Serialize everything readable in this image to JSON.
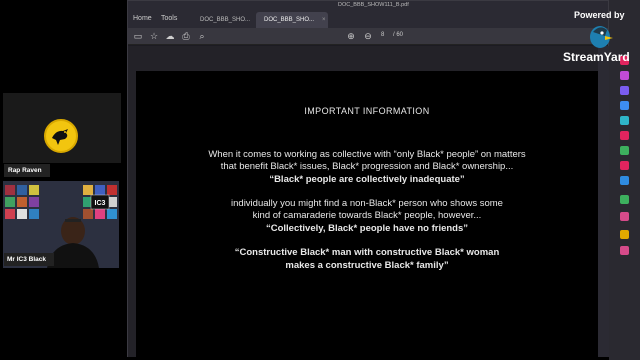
{
  "browser": {
    "menu": [
      "Home",
      "Tools"
    ],
    "tabs": [
      {
        "label": "DOC_BBB_SHO..."
      },
      {
        "label": "DOC_BBB_SHO...",
        "close": "×"
      }
    ],
    "document_title": "DOC_BBB_SHOW111_B.pdf",
    "page_current": "8",
    "page_total": "/ 60"
  },
  "participants": [
    {
      "name": "Rap Raven"
    },
    {
      "name": "Mr IC3 Black"
    }
  ],
  "webcam": {
    "sign_text": "IC3"
  },
  "slide": {
    "heading": "IMPORTANT INFORMATION",
    "line1": "When it comes to working as collective with “only Black* people” on matters",
    "line2": "that benefit Black* issues, Black* progression and Black* ownership...",
    "line3": "“Black* people are collectively inadequate”",
    "line4": "individually you might find a non-Black* person who shows some",
    "line5": "kind of camaraderie towards Black* people, however...",
    "line6": "“Collectively, Black* people have no friends”",
    "line7": "“Constructive Black* man with constructive Black* woman",
    "line8": "makes a constructive Black* family”"
  },
  "branding": {
    "powered_by": "Powered by",
    "name": "StreamYard"
  },
  "colors": {
    "raven_logo": "#f2c50f",
    "rail_icons": [
      "#e0245e",
      "#c04bd6",
      "#7a5cf0",
      "#3d8cf0",
      "#2fb5c8",
      "#e0245e",
      "#3db05e",
      "#e0245e",
      "#2f8be0",
      "#3db05e",
      "#d64b8a",
      "#e0a800",
      "#d64b8a"
    ]
  }
}
